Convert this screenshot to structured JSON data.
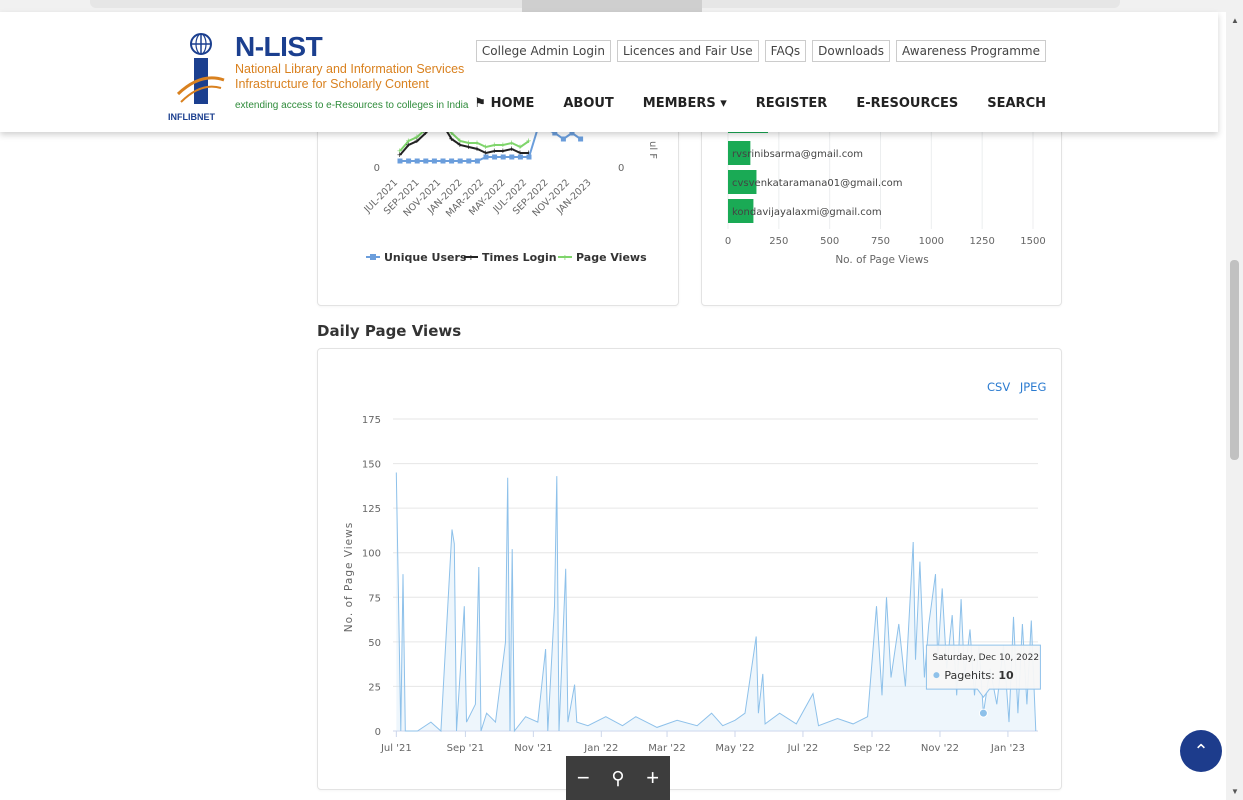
{
  "header": {
    "logo_org": "INFLIBNET",
    "brand_name": "N-LIST",
    "brand_line1": "National Library and Information Services",
    "brand_line2": "Infrastructure for Scholarly Content",
    "brand_tagline": "extending access to e-Resources to colleges in India",
    "top_links": [
      "College Admin Login",
      "Licences and Fair Use",
      "FAQs",
      "Downloads",
      "Awareness Programme"
    ],
    "nav": [
      "HOME",
      "ABOUT",
      "MEMBERS",
      "REGISTER",
      "E-RESOURCES",
      "SEARCH"
    ],
    "home_icon": "home-icon",
    "members_caret": "caret-down-icon"
  },
  "left_chart": {
    "y_zero": "0",
    "x_ticks": [
      "JUL-2021",
      "SEP-2021",
      "NOV-2021",
      "JAN-2022",
      "MAR-2022",
      "MAY-2022",
      "JUL-2022",
      "SEP-2022",
      "NOV-2022",
      "JAN-2023"
    ],
    "legend": [
      "Unique Users",
      "Times Login",
      "Page Views"
    ],
    "right_axis_zero": "0",
    "right_axis_label": "ul F",
    "colors": {
      "Unique Users": "#6b9edc",
      "Times Login": "#222222",
      "Page Views": "#7fd56b"
    }
  },
  "right_chart": {
    "bars": [
      {
        "label": "rvsrinibsarma@gmail.com",
        "value": 110
      },
      {
        "label": "cvsvenkataramana01@gmail.com",
        "value": 140
      },
      {
        "label": "kondavijayalaxmi@gmail.com",
        "value": 125
      }
    ],
    "x_ticks": [
      "0",
      "250",
      "500",
      "750",
      "1000",
      "1250",
      "1500"
    ],
    "x_label": "No. of Page Views",
    "bar_color": "#1aaa55"
  },
  "daily": {
    "section_title": "Daily Page Views",
    "export": [
      "CSV",
      "JPEG"
    ],
    "y_label": "No. of Page Views",
    "tooltip_date": "Saturday, Dec 10, 2022",
    "tooltip_series": "Pagehits",
    "tooltip_value": "10"
  },
  "chart_data": {
    "type": "area",
    "x_ticks": [
      "Jul '21",
      "Sep '21",
      "Nov '21",
      "Jan '22",
      "Mar '22",
      "May '22",
      "Jul '22",
      "Sep '22",
      "Nov '22",
      "Jan '23"
    ],
    "y_ticks": [
      0,
      25,
      50,
      75,
      100,
      125,
      150,
      175
    ],
    "ylim": [
      0,
      175
    ],
    "ylabel": "No. of Page Views",
    "series": [
      {
        "name": "Pagehits",
        "color": "#8ec1ea",
        "points": [
          [
            "2021-07-01",
            145
          ],
          [
            "2021-07-05",
            0
          ],
          [
            "2021-07-07",
            88
          ],
          [
            "2021-07-09",
            0
          ],
          [
            "2021-07-20",
            0
          ],
          [
            "2021-08-01",
            5
          ],
          [
            "2021-08-10",
            0
          ],
          [
            "2021-08-20",
            113
          ],
          [
            "2021-08-22",
            105
          ],
          [
            "2021-08-24",
            0
          ],
          [
            "2021-08-28",
            40
          ],
          [
            "2021-08-31",
            70
          ],
          [
            "2021-09-02",
            5
          ],
          [
            "2021-09-10",
            15
          ],
          [
            "2021-09-13",
            92
          ],
          [
            "2021-09-15",
            0
          ],
          [
            "2021-09-20",
            10
          ],
          [
            "2021-09-28",
            5
          ],
          [
            "2021-10-07",
            50
          ],
          [
            "2021-10-09",
            142
          ],
          [
            "2021-10-11",
            0
          ],
          [
            "2021-10-13",
            102
          ],
          [
            "2021-10-15",
            0
          ],
          [
            "2021-10-25",
            8
          ],
          [
            "2021-11-05",
            5
          ],
          [
            "2021-11-12",
            46
          ],
          [
            "2021-11-14",
            0
          ],
          [
            "2021-11-20",
            70
          ],
          [
            "2021-11-22",
            143
          ],
          [
            "2021-11-24",
            0
          ],
          [
            "2021-11-30",
            91
          ],
          [
            "2021-12-02",
            5
          ],
          [
            "2021-12-08",
            26
          ],
          [
            "2021-12-10",
            5
          ],
          [
            "2021-12-20",
            3
          ],
          [
            "2022-01-05",
            8
          ],
          [
            "2022-01-20",
            3
          ],
          [
            "2022-02-01",
            8
          ],
          [
            "2022-02-20",
            2
          ],
          [
            "2022-03-10",
            6
          ],
          [
            "2022-03-28",
            3
          ],
          [
            "2022-04-10",
            10
          ],
          [
            "2022-04-20",
            3
          ],
          [
            "2022-05-01",
            6
          ],
          [
            "2022-05-10",
            10
          ],
          [
            "2022-05-20",
            53
          ],
          [
            "2022-05-22",
            10
          ],
          [
            "2022-05-26",
            32
          ],
          [
            "2022-05-28",
            4
          ],
          [
            "2022-06-10",
            10
          ],
          [
            "2022-06-25",
            4
          ],
          [
            "2022-07-10",
            21
          ],
          [
            "2022-07-15",
            3
          ],
          [
            "2022-08-01",
            7
          ],
          [
            "2022-08-15",
            4
          ],
          [
            "2022-08-28",
            8
          ],
          [
            "2022-09-05",
            70
          ],
          [
            "2022-09-10",
            20
          ],
          [
            "2022-09-14",
            75
          ],
          [
            "2022-09-18",
            30
          ],
          [
            "2022-09-25",
            60
          ],
          [
            "2022-10-01",
            25
          ],
          [
            "2022-10-08",
            106
          ],
          [
            "2022-10-10",
            40
          ],
          [
            "2022-10-14",
            95
          ],
          [
            "2022-10-18",
            30
          ],
          [
            "2022-10-22",
            60
          ],
          [
            "2022-10-28",
            88
          ],
          [
            "2022-10-30",
            40
          ],
          [
            "2022-11-03",
            80
          ],
          [
            "2022-11-07",
            35
          ],
          [
            "2022-11-12",
            65
          ],
          [
            "2022-11-16",
            20
          ],
          [
            "2022-11-20",
            74
          ],
          [
            "2022-11-23",
            30
          ],
          [
            "2022-11-28",
            57
          ],
          [
            "2022-12-02",
            20
          ],
          [
            "2022-12-06",
            48
          ],
          [
            "2022-12-10",
            10
          ],
          [
            "2022-12-16",
            35
          ],
          [
            "2022-12-22",
            15
          ],
          [
            "2022-12-28",
            48
          ],
          [
            "2023-01-02",
            5
          ],
          [
            "2023-01-06",
            64
          ],
          [
            "2023-01-10",
            10
          ],
          [
            "2023-01-14",
            60
          ],
          [
            "2023-01-18",
            15
          ],
          [
            "2023-01-22",
            62
          ],
          [
            "2023-01-26",
            0
          ]
        ]
      }
    ],
    "grid": true,
    "tooltip_point": [
      "2022-12-10",
      10
    ]
  }
}
